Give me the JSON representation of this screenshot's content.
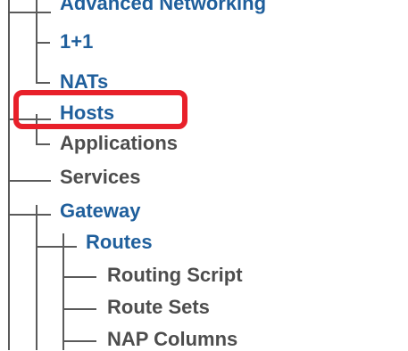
{
  "tree": {
    "items": [
      {
        "label": "Advanced Networking"
      },
      {
        "label": "1+1"
      },
      {
        "label": "NATs"
      },
      {
        "label": "Hosts"
      },
      {
        "label": "Applications"
      },
      {
        "label": "Services"
      },
      {
        "label": "Gateway"
      },
      {
        "label": "Routes"
      },
      {
        "label": "Routing Script"
      },
      {
        "label": "Route Sets"
      },
      {
        "label": "NAP Columns"
      }
    ]
  },
  "colors": {
    "link": "#1f5f9c",
    "muted": "#4d4d4d",
    "connector": "#5a5a5a",
    "highlight": "#e8202a"
  }
}
